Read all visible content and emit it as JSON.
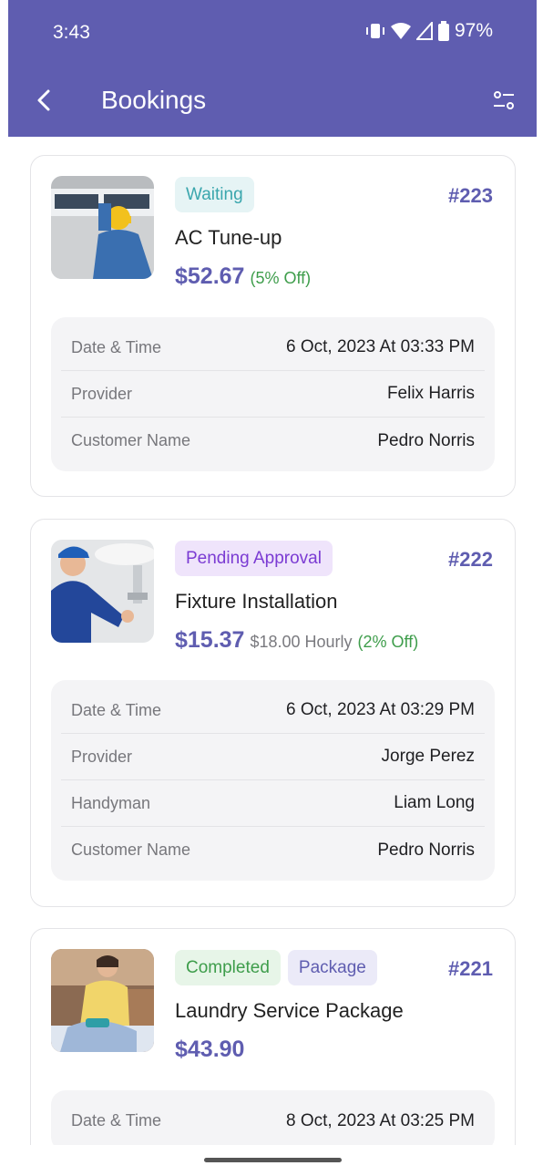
{
  "status_bar": {
    "time": "3:43",
    "battery": "97%"
  },
  "header": {
    "title": "Bookings"
  },
  "bookings": [
    {
      "status": "Waiting",
      "id": "#223",
      "service": "AC Tune-up",
      "price": "$52.67",
      "discount": "(5% Off)",
      "rows": [
        {
          "label": "Date & Time",
          "value": "6 Oct, 2023 At 03:33 PM"
        },
        {
          "label": "Provider",
          "value": "Felix Harris"
        },
        {
          "label": "Customer Name",
          "value": "Pedro Norris"
        }
      ]
    },
    {
      "status": "Pending Approval",
      "id": "#222",
      "service": "Fixture Installation",
      "price": "$15.37",
      "hourly": "$18.00 Hourly",
      "discount": "(2% Off)",
      "rows": [
        {
          "label": "Date & Time",
          "value": "6 Oct, 2023 At 03:29 PM"
        },
        {
          "label": "Provider",
          "value": "Jorge Perez"
        },
        {
          "label": "Handyman",
          "value": "Liam Long"
        },
        {
          "label": "Customer Name",
          "value": "Pedro Norris"
        }
      ]
    },
    {
      "status": "Completed",
      "type_badge": "Package",
      "id": "#221",
      "service": "Laundry Service Package",
      "price": "$43.90",
      "rows": [
        {
          "label": "Date & Time",
          "value": "8 Oct, 2023 At 03:25 PM"
        }
      ]
    }
  ],
  "colors": {
    "primary": "#5f5db0",
    "waiting": "#3aa6ad",
    "pending": "#7b3bd3",
    "completed": "#3e9d4b"
  }
}
